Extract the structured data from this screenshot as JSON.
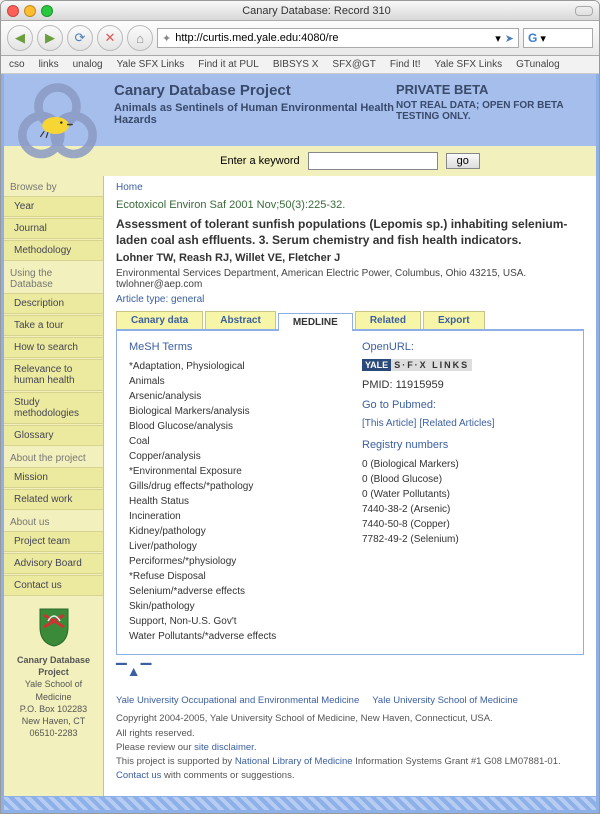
{
  "window": {
    "title": "Canary Database: Record 310"
  },
  "toolbar": {
    "url": "http://curtis.med.yale.edu:4080/re",
    "search_placeholder": ""
  },
  "bookmarks": [
    "cso",
    "links",
    "unalog",
    "Yale SFX Links",
    "Find it at PUL",
    "BIBSYS X",
    "SFX@GT",
    "Find It!",
    "Yale SFX Links",
    "GTunalog"
  ],
  "header": {
    "title": "Canary Database Project",
    "subtitle": "Animals as Sentinels of Human Environmental Health Hazards",
    "beta": "PRIVATE BETA",
    "beta_sub": "NOT REAL DATA; OPEN FOR BETA TESTING ONLY."
  },
  "search": {
    "label": "Enter a keyword",
    "go": "go"
  },
  "sidebar": {
    "groups": [
      {
        "label": "Browse by",
        "items": [
          "Year",
          "Journal",
          "Methodology"
        ]
      },
      {
        "label": "Using the Database",
        "items": [
          "Description",
          "Take a tour",
          "How to search",
          "Relevance to human health",
          "Study methodologies",
          "Glossary"
        ]
      },
      {
        "label": "About the project",
        "items": [
          "Mission",
          "Related work"
        ]
      },
      {
        "label": "About us",
        "items": [
          "Project team",
          "Advisory Board",
          "Contact us"
        ]
      }
    ],
    "org": {
      "name": "Canary Database Project",
      "lines": [
        "Yale School of Medicine",
        "P.O. Box 102283",
        "New Haven, CT",
        "06510-2283"
      ]
    }
  },
  "record": {
    "crumb": "Home",
    "citation": "Ecotoxicol Environ Saf 2001 Nov;50(3):225-32.",
    "title": "Assessment of tolerant sunfish populations (Lepomis sp.) inhabiting selenium-laden coal ash effluents. 3. Serum chemistry and fish health indicators.",
    "authors": "Lohner TW, Reash RJ, Willet VE, Fletcher J",
    "affiliation": "Environmental Services Department, American Electric Power, Columbus, Ohio 43215, USA. twlohner@aep.com",
    "article_type_label": "Article type:",
    "article_type": "general",
    "tabs": [
      "Canary data",
      "Abstract",
      "MEDLINE",
      "Related",
      "Export"
    ],
    "active_tab": 2,
    "mesh_heading": "MeSH Terms",
    "mesh_terms": [
      "*Adaptation, Physiological",
      "Animals",
      "Arsenic/analysis",
      "Biological Markers/analysis",
      "Blood Glucose/analysis",
      "Coal",
      "Copper/analysis",
      "*Environmental Exposure",
      "Gills/drug effects/*pathology",
      "Health Status",
      "Incineration",
      "Kidney/pathology",
      "Liver/pathology",
      "Perciformes/*physiology",
      "*Refuse Disposal",
      "Selenium/*adverse effects",
      "Skin/pathology",
      "Support, Non-U.S. Gov't",
      "Water Pollutants/*adverse effects"
    ],
    "openurl_label": "OpenURL:",
    "openurl_badge_yale": "YALE",
    "openurl_badge_sfx": "S·F·X LINKS",
    "pmid_label": "PMID:",
    "pmid": "11915959",
    "goto_pubmed": "Go to Pubmed:",
    "pubmed_links": [
      "[This Article]",
      "[Related Articles]"
    ],
    "registry_heading": "Registry numbers",
    "registry": [
      "0 (Biological Markers)",
      "0 (Blood Glucose)",
      "0 (Water Pollutants)",
      "7440-38-2 (Arsenic)",
      "7440-50-8 (Copper)",
      "7782-49-2 (Selenium)"
    ]
  },
  "footer": {
    "link1": "Yale University Occupational and Environmental Medicine",
    "link2": "Yale University School of Medicine",
    "copyright": "Copyright 2004-2005, Yale University School of Medicine, New Haven, Connecticut, USA.",
    "rights": "All rights reserved.",
    "review_pre": "Please review our ",
    "review_link": "site disclaimer",
    "review_post": ".",
    "support_pre": "This project is supported by ",
    "support_link": "National Library of Medicine",
    "support_post": " Information Systems Grant #1 G08 LM07881-01.",
    "contact_link": "Contact us",
    "contact_post": " with comments or suggestions."
  }
}
